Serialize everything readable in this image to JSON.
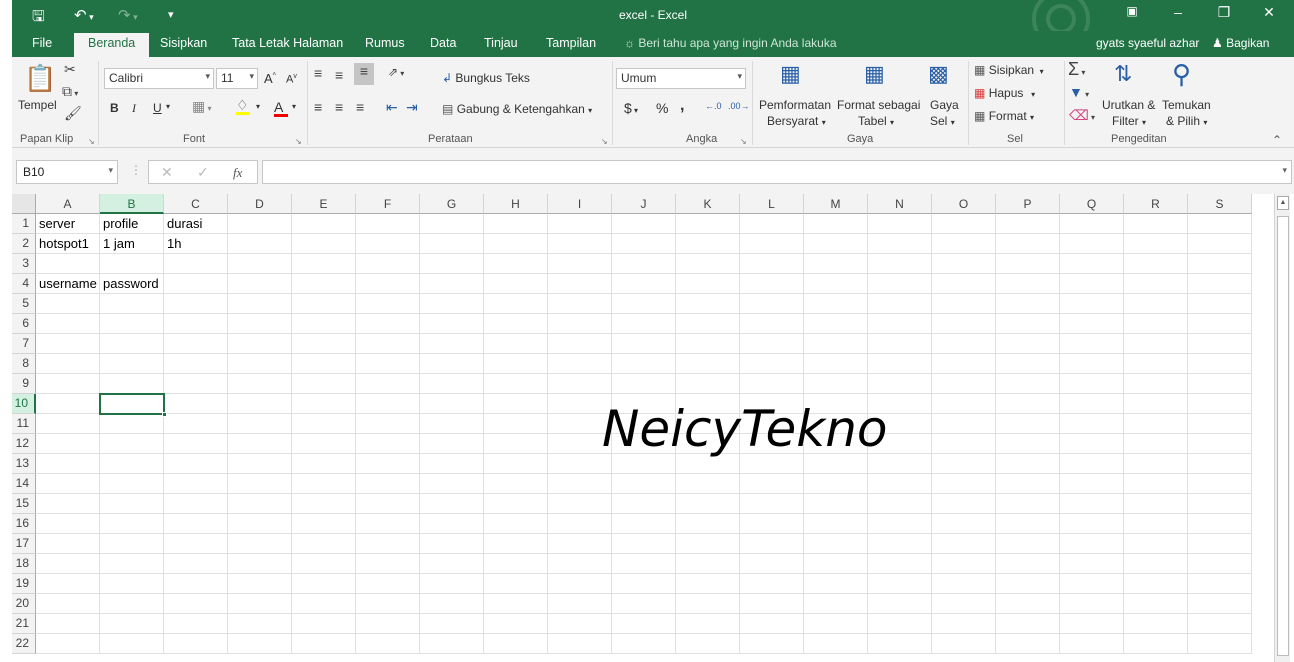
{
  "titlebar": {
    "title": "excel - Excel",
    "save_icon": "save-icon",
    "undo_icon": "undo-icon",
    "redo_icon": "redo-icon",
    "customize_icon": "customize-quick-access-icon",
    "ribbon_display_icon": "ribbon-display-options-icon",
    "minimize": "–",
    "restore": "❐",
    "close": "✕",
    "bg_color": "#217346"
  },
  "tabs": {
    "items": [
      "File",
      "Beranda",
      "Sisipkan",
      "Tata Letak Halaman",
      "Rumus",
      "Data",
      "Tinjau",
      "Tampilan"
    ],
    "active": "Beranda",
    "tell_me": "Beri tahu apa yang ingin Anda lakuka",
    "user": "gyats syaeful azhar",
    "share": "Bagikan"
  },
  "ribbon": {
    "clipboard": {
      "paste": "Tempel",
      "group": "Papan Klip"
    },
    "font": {
      "name": "Calibri",
      "size": "11",
      "bold": "B",
      "italic": "I",
      "underline": "U",
      "grow": "A",
      "shrink": "A",
      "font_color_letter": "A",
      "group": "Font"
    },
    "alignment": {
      "wrap": "Bungkus Teks",
      "merge": "Gabung & Ketengahkan",
      "group": "Perataan"
    },
    "number": {
      "format": "Umum",
      "currency": "$",
      "percent": "%",
      "comma": ",",
      "group": "Angka"
    },
    "styles": {
      "conditional_1": "Pemformatan",
      "conditional_2": "Bersyarat",
      "table_1": "Format sebagai",
      "table_2": "Tabel",
      "cell_1": "Gaya",
      "cell_2": "Sel",
      "group": "Gaya"
    },
    "cells": {
      "insert": "Sisipkan",
      "delete": "Hapus",
      "format": "Format",
      "group": "Sel"
    },
    "editing": {
      "sort_1": "Urutkan &",
      "sort_2": "Filter",
      "find_1": "Temukan",
      "find_2": "& Pilih",
      "group": "Pengeditan"
    }
  },
  "formula_bar": {
    "name_box": "B10",
    "formula": "",
    "fx": "fx"
  },
  "sheet": {
    "columns": [
      "A",
      "B",
      "C",
      "D",
      "E",
      "F",
      "G",
      "H",
      "I",
      "J",
      "K",
      "L",
      "M",
      "N",
      "O",
      "P",
      "Q",
      "R",
      "S"
    ],
    "rows": [
      "1",
      "2",
      "3",
      "4",
      "5",
      "6",
      "7",
      "8",
      "9",
      "10",
      "11",
      "12",
      "13",
      "14",
      "15",
      "16",
      "17",
      "18",
      "19",
      "20",
      "21",
      "22"
    ],
    "selected_column": "B",
    "selected_row": "10",
    "cells": {
      "A1": "server",
      "B1": "profile",
      "C1": "durasi",
      "A2": "hotspot1",
      "B2": "1 jam",
      "C2": "1h",
      "A4": "username",
      "B4": "password"
    },
    "watermark": "NeicyTekno"
  }
}
